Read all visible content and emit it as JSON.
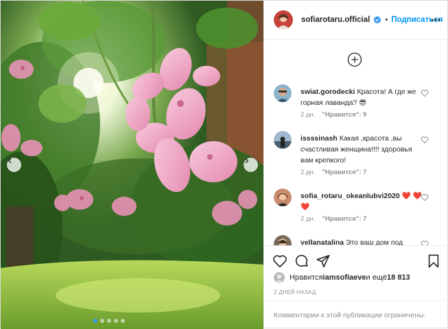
{
  "post": {
    "image": {
      "alt_subject": "pink-geranium-garden-photo",
      "colors": {
        "sky": "#eef6e6",
        "foliage": "#4f8a33",
        "lawn": "#8dbd3a",
        "flower": "#f0a6c4",
        "flower_dark": "#c25a86"
      },
      "carousel": {
        "slides": 5,
        "active_index": 0
      }
    },
    "header": {
      "username": "sofiarotaru.official",
      "separator": "•",
      "follow_label": "Подписаться",
      "verified_icon": "verified-badge-icon",
      "more_icon": "more-options-icon"
    },
    "comments": [
      {
        "user": "swiat.gorodecki",
        "text": "Красота! А где же горная лаванда? 😎",
        "time": "2 дн.",
        "likes": "\"Нравится\": 9",
        "avatar_color": "#8ab4c9"
      },
      {
        "user": "issssinash",
        "text": "Какая ,красота ,вы счастливая женщина!!!! здоровья вам крепкого!",
        "time": "2 дн.",
        "likes": "\"Нравится\": 7",
        "avatar_color": "#5b7fa6"
      },
      {
        "user": "sofia_rotaru_okeanlubvi2020",
        "text": "❤️ ❤️ ❤️",
        "time": "2 дн.",
        "likes": "\"Нравится\": 7",
        "avatar_color": "#c98a6b"
      },
      {
        "user": "vellanatalina",
        "text": "Это ваш дом под",
        "time": "",
        "likes": "",
        "avatar_color": "#7a6a5c"
      }
    ],
    "load_more_icon": "plus-circle-icon",
    "actions": {
      "like_icon": "heart-outline-icon",
      "comment_icon": "comment-bubble-icon",
      "share_icon": "paper-plane-icon",
      "save_icon": "bookmark-icon"
    },
    "likes": {
      "prefix": "Нравится ",
      "user": "iamsofiaeve",
      "suffix": " и ещё ",
      "count": "18 813"
    },
    "date": "2 ДНЕЙ НАЗАД",
    "comments_closed": "Комментарии к этой публикации ограничены.",
    "accent_color": "#0095f6"
  }
}
